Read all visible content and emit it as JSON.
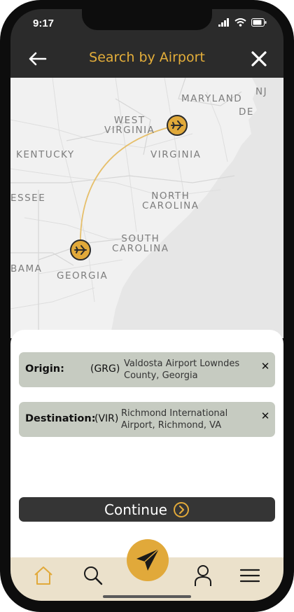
{
  "status": {
    "time": "9:17"
  },
  "header": {
    "title": "Search by Airport"
  },
  "map": {
    "states": [
      {
        "label": "MARYLAND"
      },
      {
        "label": "NJ"
      },
      {
        "label": "DE"
      },
      {
        "label": "WEST\nVIRGINIA"
      },
      {
        "label": "VIRGINIA"
      },
      {
        "label": "KENTUCKY"
      },
      {
        "label": "ESSEE"
      },
      {
        "label": "NORTH\nCAROLINA"
      },
      {
        "label": "SOUTH\nCAROLINA"
      },
      {
        "label": "BAMA"
      },
      {
        "label": "GEORGIA"
      }
    ],
    "route_color": "#e6bf6b"
  },
  "origin": {
    "label": "Origin:",
    "code": "(GRG)",
    "name": "Valdosta Airport Lowndes County, Georgia"
  },
  "destination": {
    "label": "Destination:",
    "code": "(VIR)",
    "name": "Richmond International Airport, Richmond, VA"
  },
  "continue": {
    "label": "Continue"
  },
  "nav": {
    "items": [
      "home-icon",
      "search-icon",
      "send-icon",
      "profile-icon",
      "menu-icon"
    ],
    "accent": "#e1a93a"
  },
  "colors": {
    "accent": "#e4ae3a",
    "field_bg": "#c6cbc1",
    "nav_bg": "#ebe1cb"
  }
}
